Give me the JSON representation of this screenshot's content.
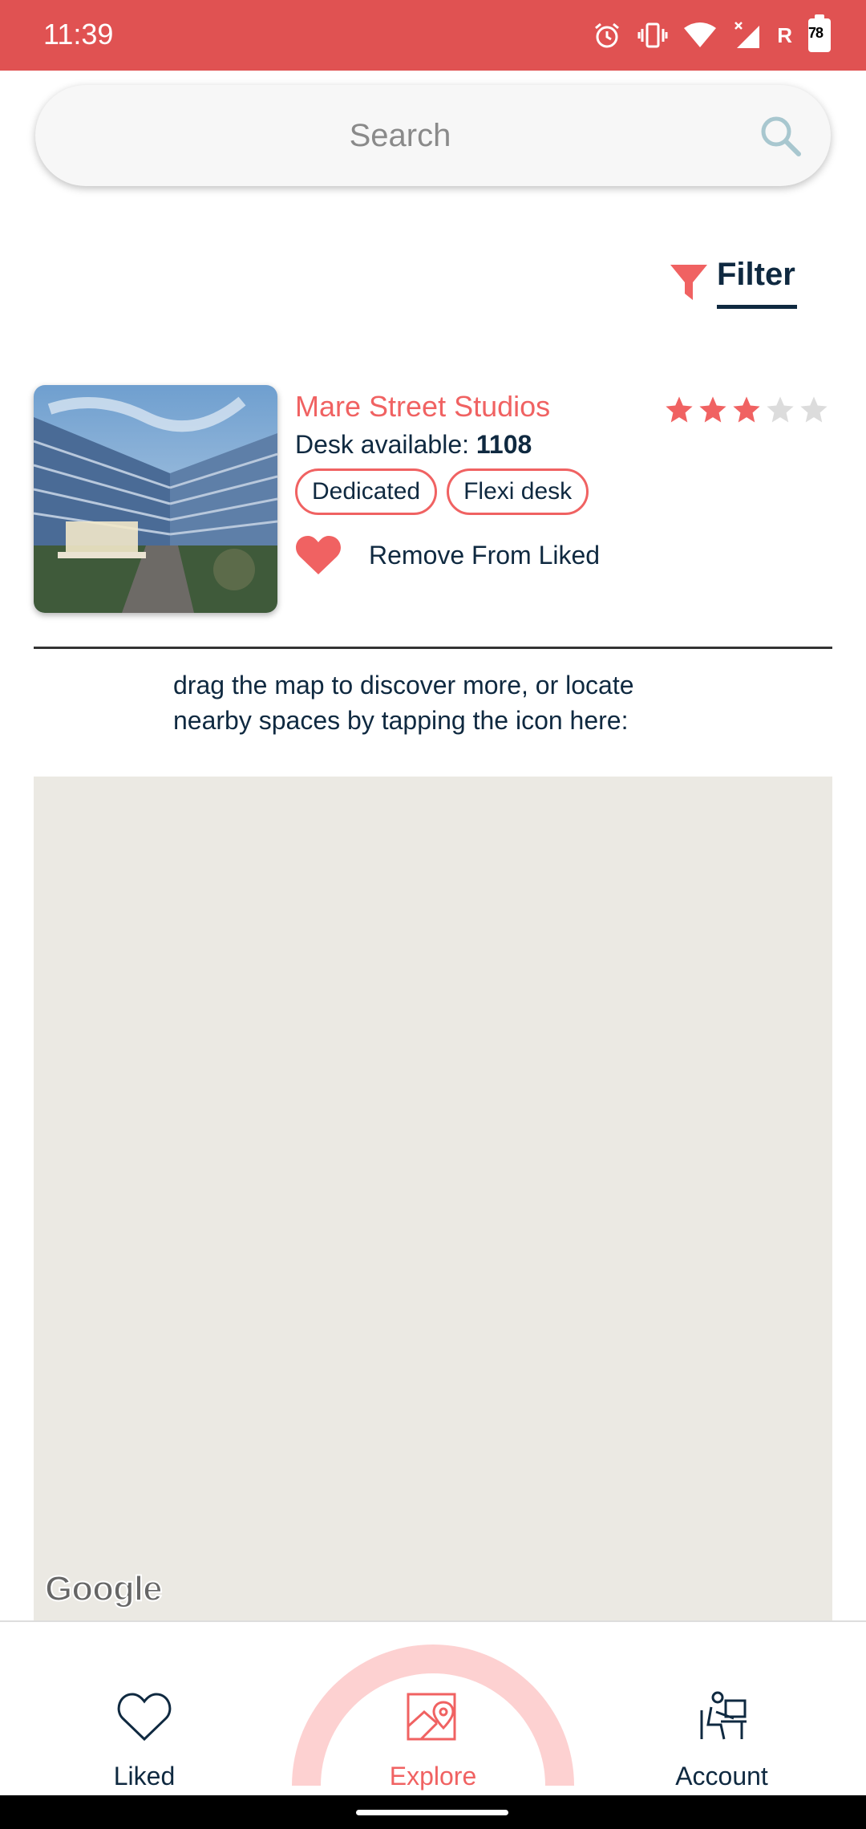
{
  "status_bar": {
    "time": "11:39",
    "network_label": "R",
    "battery_level": "78",
    "icons": [
      "alarm-icon",
      "vibrate-icon",
      "wifi-icon",
      "signal-icon",
      "battery-icon"
    ]
  },
  "search": {
    "placeholder": "Search",
    "value": ""
  },
  "filter": {
    "label": "Filter",
    "icon": "funnel-icon"
  },
  "listing": {
    "title": "Mare Street Studios",
    "desk_label": "Desk available:",
    "desk_count": "1108",
    "rating": 3,
    "rating_max": 5,
    "tags": [
      "Dedicated",
      "Flexi desk"
    ],
    "like_action": "Remove From Liked"
  },
  "hint": {
    "line1": "drag the map to discover more, or locate",
    "line2": "nearby spaces by tapping the icon here:"
  },
  "map": {
    "attribution": "Google"
  },
  "nav": {
    "liked": "Liked",
    "explore": "Explore",
    "account": "Account",
    "active": "Explore"
  },
  "colors": {
    "accent": "#f06262",
    "status_bar": "#e05252",
    "text_dark": "#0f2940",
    "map_bg": "#ebe9e3",
    "arc": "#fdd1d1"
  }
}
